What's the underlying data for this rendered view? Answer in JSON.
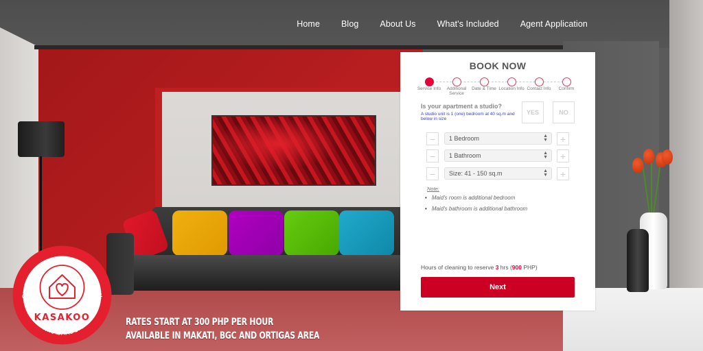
{
  "nav": {
    "items": [
      {
        "label": "Home"
      },
      {
        "label": "Blog"
      },
      {
        "label": "About Us"
      },
      {
        "label": "What's Included"
      },
      {
        "label": "Agent Application"
      }
    ]
  },
  "booking": {
    "title": "BOOK NOW",
    "steps": [
      {
        "label": "Service Info",
        "state": "active"
      },
      {
        "label": "Additional Service",
        "state": "pending"
      },
      {
        "label": "Date & Time",
        "state": "pending"
      },
      {
        "label": "Location Info",
        "state": "pending"
      },
      {
        "label": "Contact Info",
        "state": "pending"
      },
      {
        "label": "Confirm",
        "state": "pending"
      }
    ],
    "studio_question": "Is your apartment a studio?",
    "studio_note": "A studio unit is 1 (one) bedroom at 40 sq.m and below in size",
    "yes_label": "YES",
    "no_label": "NO",
    "selects": [
      {
        "value": "1 Bedroom"
      },
      {
        "value": "1 Bathroom"
      },
      {
        "value": "Size: 41 - 150 sq.m"
      }
    ],
    "minus_glyph": "−",
    "plus_glyph": "+",
    "note_label": "Note:",
    "notes": [
      "Maid's room is additional bedroom",
      "Maid's bathroom is additional bathroom"
    ],
    "hours": {
      "prefix": "Hours of cleaning to reserve",
      "hours_value": "3",
      "hours_unit": "hrs (",
      "price_value": "900",
      "price_unit": "PHP)"
    },
    "next_label": "Next"
  },
  "brand": {
    "name": "KASAKOO",
    "arc_top": "A CLEAN HOME JUST CLICKS AWAY",
    "arc_bottom": "WWW.KASAKOO.COM",
    "color": "#e5202e"
  },
  "promo": {
    "line1": "RATES START AT 300 PHP PER HOUR",
    "line2": "AVAILABLE IN MAKATI, BGC AND ORTIGAS AREA"
  },
  "colors": {
    "accent": "#cc0022",
    "step_active": "#e5003a",
    "note_link": "#3b3bd6"
  }
}
